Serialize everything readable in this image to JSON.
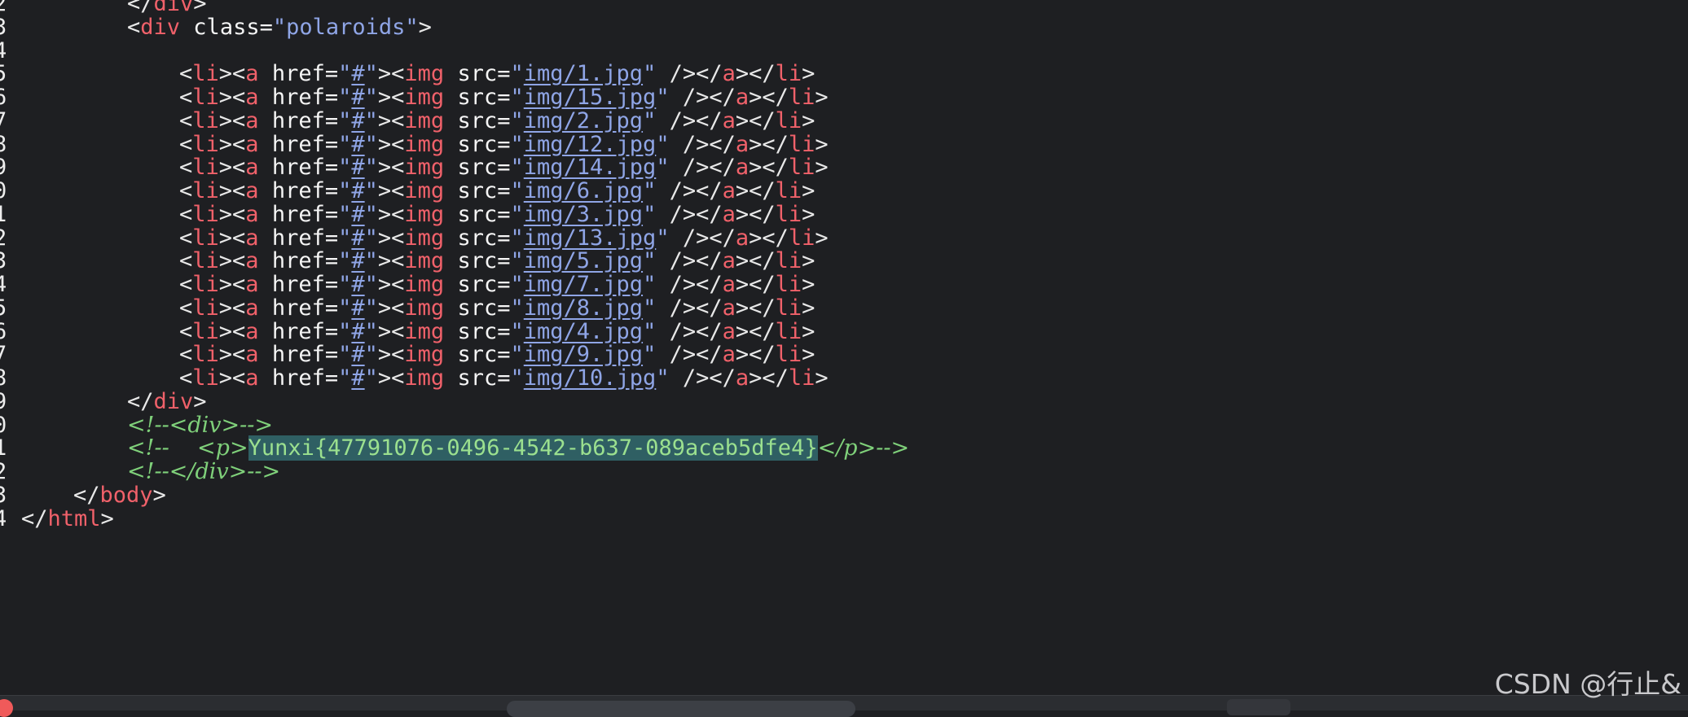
{
  "editor": {
    "language": "html",
    "line_numbers": [
      "2",
      "3",
      "4",
      "5",
      "6",
      "7",
      "8",
      "9",
      "0",
      "1",
      "2",
      "3",
      "4",
      "5",
      "6",
      "7",
      "8",
      "9",
      "0",
      "1",
      "2",
      "3",
      "4"
    ],
    "lines": [
      [
        {
          "t": "pun",
          "v": "</"
        },
        {
          "t": "tag",
          "v": "div"
        },
        {
          "t": "pun",
          "v": ">"
        }
      ],
      [
        {
          "t": "pun",
          "v": "<"
        },
        {
          "t": "tag",
          "v": "div"
        },
        {
          "t": "atr",
          "v": " class="
        },
        {
          "t": "str",
          "v": "\"polaroids\""
        },
        {
          "t": "pun",
          "v": ">"
        }
      ],
      [],
      [
        {
          "t": "pun",
          "v": "<"
        },
        {
          "t": "tag",
          "v": "li"
        },
        {
          "t": "pun",
          "v": "><"
        },
        {
          "t": "tag",
          "v": "a"
        },
        {
          "t": "atr",
          "v": " href="
        },
        {
          "t": "str",
          "v": "\""
        },
        {
          "t": "lnk",
          "v": "#"
        },
        {
          "t": "str",
          "v": "\""
        },
        {
          "t": "pun",
          "v": "><"
        },
        {
          "t": "tag",
          "v": "img"
        },
        {
          "t": "atr",
          "v": " src="
        },
        {
          "t": "str",
          "v": "\""
        },
        {
          "t": "lnk",
          "v": "img/1.jpg"
        },
        {
          "t": "str",
          "v": "\""
        },
        {
          "t": "pun",
          "v": " /></"
        },
        {
          "t": "tag",
          "v": "a"
        },
        {
          "t": "pun",
          "v": "></"
        },
        {
          "t": "tag",
          "v": "li"
        },
        {
          "t": "pun",
          "v": ">"
        }
      ],
      [
        {
          "t": "pun",
          "v": "<"
        },
        {
          "t": "tag",
          "v": "li"
        },
        {
          "t": "pun",
          "v": "><"
        },
        {
          "t": "tag",
          "v": "a"
        },
        {
          "t": "atr",
          "v": " href="
        },
        {
          "t": "str",
          "v": "\""
        },
        {
          "t": "lnk",
          "v": "#"
        },
        {
          "t": "str",
          "v": "\""
        },
        {
          "t": "pun",
          "v": "><"
        },
        {
          "t": "tag",
          "v": "img"
        },
        {
          "t": "atr",
          "v": " src="
        },
        {
          "t": "str",
          "v": "\""
        },
        {
          "t": "lnk",
          "v": "img/15.jpg"
        },
        {
          "t": "str",
          "v": "\""
        },
        {
          "t": "pun",
          "v": " /></"
        },
        {
          "t": "tag",
          "v": "a"
        },
        {
          "t": "pun",
          "v": "></"
        },
        {
          "t": "tag",
          "v": "li"
        },
        {
          "t": "pun",
          "v": ">"
        }
      ],
      [
        {
          "t": "pun",
          "v": "<"
        },
        {
          "t": "tag",
          "v": "li"
        },
        {
          "t": "pun",
          "v": "><"
        },
        {
          "t": "tag",
          "v": "a"
        },
        {
          "t": "atr",
          "v": " href="
        },
        {
          "t": "str",
          "v": "\""
        },
        {
          "t": "lnk",
          "v": "#"
        },
        {
          "t": "str",
          "v": "\""
        },
        {
          "t": "pun",
          "v": "><"
        },
        {
          "t": "tag",
          "v": "img"
        },
        {
          "t": "atr",
          "v": " src="
        },
        {
          "t": "str",
          "v": "\""
        },
        {
          "t": "lnk",
          "v": "img/2.jpg"
        },
        {
          "t": "str",
          "v": "\""
        },
        {
          "t": "pun",
          "v": " /></"
        },
        {
          "t": "tag",
          "v": "a"
        },
        {
          "t": "pun",
          "v": "></"
        },
        {
          "t": "tag",
          "v": "li"
        },
        {
          "t": "pun",
          "v": ">"
        }
      ],
      [
        {
          "t": "pun",
          "v": "<"
        },
        {
          "t": "tag",
          "v": "li"
        },
        {
          "t": "pun",
          "v": "><"
        },
        {
          "t": "tag",
          "v": "a"
        },
        {
          "t": "atr",
          "v": " href="
        },
        {
          "t": "str",
          "v": "\""
        },
        {
          "t": "lnk",
          "v": "#"
        },
        {
          "t": "str",
          "v": "\""
        },
        {
          "t": "pun",
          "v": "><"
        },
        {
          "t": "tag",
          "v": "img"
        },
        {
          "t": "atr",
          "v": " src="
        },
        {
          "t": "str",
          "v": "\""
        },
        {
          "t": "lnk",
          "v": "img/12.jpg"
        },
        {
          "t": "str",
          "v": "\""
        },
        {
          "t": "pun",
          "v": " /></"
        },
        {
          "t": "tag",
          "v": "a"
        },
        {
          "t": "pun",
          "v": "></"
        },
        {
          "t": "tag",
          "v": "li"
        },
        {
          "t": "pun",
          "v": ">"
        }
      ],
      [
        {
          "t": "pun",
          "v": "<"
        },
        {
          "t": "tag",
          "v": "li"
        },
        {
          "t": "pun",
          "v": "><"
        },
        {
          "t": "tag",
          "v": "a"
        },
        {
          "t": "atr",
          "v": " href="
        },
        {
          "t": "str",
          "v": "\""
        },
        {
          "t": "lnk",
          "v": "#"
        },
        {
          "t": "str",
          "v": "\""
        },
        {
          "t": "pun",
          "v": "><"
        },
        {
          "t": "tag",
          "v": "img"
        },
        {
          "t": "atr",
          "v": " src="
        },
        {
          "t": "str",
          "v": "\""
        },
        {
          "t": "lnk",
          "v": "img/14.jpg"
        },
        {
          "t": "str",
          "v": "\""
        },
        {
          "t": "pun",
          "v": " /></"
        },
        {
          "t": "tag",
          "v": "a"
        },
        {
          "t": "pun",
          "v": "></"
        },
        {
          "t": "tag",
          "v": "li"
        },
        {
          "t": "pun",
          "v": ">"
        }
      ],
      [
        {
          "t": "pun",
          "v": "<"
        },
        {
          "t": "tag",
          "v": "li"
        },
        {
          "t": "pun",
          "v": "><"
        },
        {
          "t": "tag",
          "v": "a"
        },
        {
          "t": "atr",
          "v": " href="
        },
        {
          "t": "str",
          "v": "\""
        },
        {
          "t": "lnk",
          "v": "#"
        },
        {
          "t": "str",
          "v": "\""
        },
        {
          "t": "pun",
          "v": "><"
        },
        {
          "t": "tag",
          "v": "img"
        },
        {
          "t": "atr",
          "v": " src="
        },
        {
          "t": "str",
          "v": "\""
        },
        {
          "t": "lnk",
          "v": "img/6.jpg"
        },
        {
          "t": "str",
          "v": "\""
        },
        {
          "t": "pun",
          "v": " /></"
        },
        {
          "t": "tag",
          "v": "a"
        },
        {
          "t": "pun",
          "v": "></"
        },
        {
          "t": "tag",
          "v": "li"
        },
        {
          "t": "pun",
          "v": ">"
        }
      ],
      [
        {
          "t": "pun",
          "v": "<"
        },
        {
          "t": "tag",
          "v": "li"
        },
        {
          "t": "pun",
          "v": "><"
        },
        {
          "t": "tag",
          "v": "a"
        },
        {
          "t": "atr",
          "v": " href="
        },
        {
          "t": "str",
          "v": "\""
        },
        {
          "t": "lnk",
          "v": "#"
        },
        {
          "t": "str",
          "v": "\""
        },
        {
          "t": "pun",
          "v": "><"
        },
        {
          "t": "tag",
          "v": "img"
        },
        {
          "t": "atr",
          "v": " src="
        },
        {
          "t": "str",
          "v": "\""
        },
        {
          "t": "lnk",
          "v": "img/3.jpg"
        },
        {
          "t": "str",
          "v": "\""
        },
        {
          "t": "pun",
          "v": " /></"
        },
        {
          "t": "tag",
          "v": "a"
        },
        {
          "t": "pun",
          "v": "></"
        },
        {
          "t": "tag",
          "v": "li"
        },
        {
          "t": "pun",
          "v": ">"
        }
      ],
      [
        {
          "t": "pun",
          "v": "<"
        },
        {
          "t": "tag",
          "v": "li"
        },
        {
          "t": "pun",
          "v": "><"
        },
        {
          "t": "tag",
          "v": "a"
        },
        {
          "t": "atr",
          "v": " href="
        },
        {
          "t": "str",
          "v": "\""
        },
        {
          "t": "lnk",
          "v": "#"
        },
        {
          "t": "str",
          "v": "\""
        },
        {
          "t": "pun",
          "v": "><"
        },
        {
          "t": "tag",
          "v": "img"
        },
        {
          "t": "atr",
          "v": " src="
        },
        {
          "t": "str",
          "v": "\""
        },
        {
          "t": "lnk",
          "v": "img/13.jpg"
        },
        {
          "t": "str",
          "v": "\""
        },
        {
          "t": "pun",
          "v": " /></"
        },
        {
          "t": "tag",
          "v": "a"
        },
        {
          "t": "pun",
          "v": "></"
        },
        {
          "t": "tag",
          "v": "li"
        },
        {
          "t": "pun",
          "v": ">"
        }
      ],
      [
        {
          "t": "pun",
          "v": "<"
        },
        {
          "t": "tag",
          "v": "li"
        },
        {
          "t": "pun",
          "v": "><"
        },
        {
          "t": "tag",
          "v": "a"
        },
        {
          "t": "atr",
          "v": " href="
        },
        {
          "t": "str",
          "v": "\""
        },
        {
          "t": "lnk",
          "v": "#"
        },
        {
          "t": "str",
          "v": "\""
        },
        {
          "t": "pun",
          "v": "><"
        },
        {
          "t": "tag",
          "v": "img"
        },
        {
          "t": "atr",
          "v": " src="
        },
        {
          "t": "str",
          "v": "\""
        },
        {
          "t": "lnk",
          "v": "img/5.jpg"
        },
        {
          "t": "str",
          "v": "\""
        },
        {
          "t": "pun",
          "v": " /></"
        },
        {
          "t": "tag",
          "v": "a"
        },
        {
          "t": "pun",
          "v": "></"
        },
        {
          "t": "tag",
          "v": "li"
        },
        {
          "t": "pun",
          "v": ">"
        }
      ],
      [
        {
          "t": "pun",
          "v": "<"
        },
        {
          "t": "tag",
          "v": "li"
        },
        {
          "t": "pun",
          "v": "><"
        },
        {
          "t": "tag",
          "v": "a"
        },
        {
          "t": "atr",
          "v": " href="
        },
        {
          "t": "str",
          "v": "\""
        },
        {
          "t": "lnk",
          "v": "#"
        },
        {
          "t": "str",
          "v": "\""
        },
        {
          "t": "pun",
          "v": "><"
        },
        {
          "t": "tag",
          "v": "img"
        },
        {
          "t": "atr",
          "v": " src="
        },
        {
          "t": "str",
          "v": "\""
        },
        {
          "t": "lnk",
          "v": "img/7.jpg"
        },
        {
          "t": "str",
          "v": "\""
        },
        {
          "t": "pun",
          "v": " /></"
        },
        {
          "t": "tag",
          "v": "a"
        },
        {
          "t": "pun",
          "v": "></"
        },
        {
          "t": "tag",
          "v": "li"
        },
        {
          "t": "pun",
          "v": ">"
        }
      ],
      [
        {
          "t": "pun",
          "v": "<"
        },
        {
          "t": "tag",
          "v": "li"
        },
        {
          "t": "pun",
          "v": "><"
        },
        {
          "t": "tag",
          "v": "a"
        },
        {
          "t": "atr",
          "v": " href="
        },
        {
          "t": "str",
          "v": "\""
        },
        {
          "t": "lnk",
          "v": "#"
        },
        {
          "t": "str",
          "v": "\""
        },
        {
          "t": "pun",
          "v": "><"
        },
        {
          "t": "tag",
          "v": "img"
        },
        {
          "t": "atr",
          "v": " src="
        },
        {
          "t": "str",
          "v": "\""
        },
        {
          "t": "lnk",
          "v": "img/8.jpg"
        },
        {
          "t": "str",
          "v": "\""
        },
        {
          "t": "pun",
          "v": " /></"
        },
        {
          "t": "tag",
          "v": "a"
        },
        {
          "t": "pun",
          "v": "></"
        },
        {
          "t": "tag",
          "v": "li"
        },
        {
          "t": "pun",
          "v": ">"
        }
      ],
      [
        {
          "t": "pun",
          "v": "<"
        },
        {
          "t": "tag",
          "v": "li"
        },
        {
          "t": "pun",
          "v": "><"
        },
        {
          "t": "tag",
          "v": "a"
        },
        {
          "t": "atr",
          "v": " href="
        },
        {
          "t": "str",
          "v": "\""
        },
        {
          "t": "lnk",
          "v": "#"
        },
        {
          "t": "str",
          "v": "\""
        },
        {
          "t": "pun",
          "v": "><"
        },
        {
          "t": "tag",
          "v": "img"
        },
        {
          "t": "atr",
          "v": " src="
        },
        {
          "t": "str",
          "v": "\""
        },
        {
          "t": "lnk",
          "v": "img/4.jpg"
        },
        {
          "t": "str",
          "v": "\""
        },
        {
          "t": "pun",
          "v": " /></"
        },
        {
          "t": "tag",
          "v": "a"
        },
        {
          "t": "pun",
          "v": "></"
        },
        {
          "t": "tag",
          "v": "li"
        },
        {
          "t": "pun",
          "v": ">"
        }
      ],
      [
        {
          "t": "pun",
          "v": "<"
        },
        {
          "t": "tag",
          "v": "li"
        },
        {
          "t": "pun",
          "v": "><"
        },
        {
          "t": "tag",
          "v": "a"
        },
        {
          "t": "atr",
          "v": " href="
        },
        {
          "t": "str",
          "v": "\""
        },
        {
          "t": "lnk",
          "v": "#"
        },
        {
          "t": "str",
          "v": "\""
        },
        {
          "t": "pun",
          "v": "><"
        },
        {
          "t": "tag",
          "v": "img"
        },
        {
          "t": "atr",
          "v": " src="
        },
        {
          "t": "str",
          "v": "\""
        },
        {
          "t": "lnk",
          "v": "img/9.jpg"
        },
        {
          "t": "str",
          "v": "\""
        },
        {
          "t": "pun",
          "v": " /></"
        },
        {
          "t": "tag",
          "v": "a"
        },
        {
          "t": "pun",
          "v": "></"
        },
        {
          "t": "tag",
          "v": "li"
        },
        {
          "t": "pun",
          "v": ">"
        }
      ],
      [
        {
          "t": "pun",
          "v": "<"
        },
        {
          "t": "tag",
          "v": "li"
        },
        {
          "t": "pun",
          "v": "><"
        },
        {
          "t": "tag",
          "v": "a"
        },
        {
          "t": "atr",
          "v": " href="
        },
        {
          "t": "str",
          "v": "\""
        },
        {
          "t": "lnk",
          "v": "#"
        },
        {
          "t": "str",
          "v": "\""
        },
        {
          "t": "pun",
          "v": "><"
        },
        {
          "t": "tag",
          "v": "img"
        },
        {
          "t": "atr",
          "v": " src="
        },
        {
          "t": "str",
          "v": "\""
        },
        {
          "t": "lnk",
          "v": "img/10.jpg"
        },
        {
          "t": "str",
          "v": "\""
        },
        {
          "t": "pun",
          "v": " /></"
        },
        {
          "t": "tag",
          "v": "a"
        },
        {
          "t": "pun",
          "v": "></"
        },
        {
          "t": "tag",
          "v": "li"
        },
        {
          "t": "pun",
          "v": ">"
        }
      ],
      [
        {
          "t": "pun",
          "v": "</"
        },
        {
          "t": "tag",
          "v": "div"
        },
        {
          "t": "pun",
          "v": ">"
        }
      ],
      [
        {
          "t": "cmt",
          "v": "<!--<div>-->"
        }
      ],
      [
        {
          "t": "cmt",
          "v": "<!--    <p>"
        },
        {
          "t": "hl",
          "v": "Yunxi{47791076-0496-4542-b637-089aceb5dfe4}"
        },
        {
          "t": "cmt",
          "v": "</p>-->"
        }
      ],
      [
        {
          "t": "cmt",
          "v": "<!--</div>-->"
        }
      ],
      [
        {
          "t": "pun",
          "v": "</"
        },
        {
          "t": "tag",
          "v": "body"
        },
        {
          "t": "pun",
          "v": ">"
        }
      ],
      [
        {
          "t": "pun",
          "v": "</"
        },
        {
          "t": "tag",
          "v": "html"
        },
        {
          "t": "pun",
          "v": ">"
        }
      ]
    ]
  },
  "watermark": {
    "text": "CSDN @行止&"
  },
  "colors": {
    "background": "#1e1f22",
    "tag": "#f0616a",
    "string": "#8fa5e6",
    "comment": "#7fd07a",
    "highlight": "#2f5f63",
    "error_dot": "#f05a5a"
  }
}
